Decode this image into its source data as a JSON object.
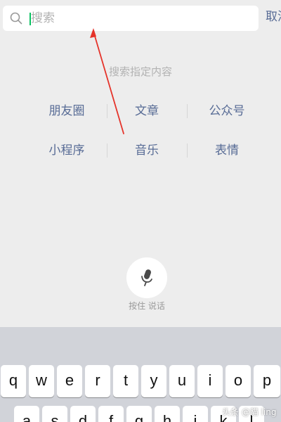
{
  "search": {
    "placeholder": "搜索",
    "cancel_label": "取消"
  },
  "hint": "搜索指定内容",
  "categories": [
    {
      "label": "朋友圈"
    },
    {
      "label": "文章"
    },
    {
      "label": "公众号"
    },
    {
      "label": "小程序"
    },
    {
      "label": "音乐"
    },
    {
      "label": "表情"
    }
  ],
  "voice": {
    "label": "按住 说话"
  },
  "keyboard": {
    "row1": [
      "q",
      "w",
      "e",
      "r",
      "t",
      "y",
      "u",
      "i",
      "o",
      "p"
    ],
    "row2": [
      "a",
      "s",
      "d",
      "f",
      "g",
      "h",
      "j",
      "k",
      "l"
    ]
  },
  "watermark": "头条 @貓 ling",
  "colors": {
    "accent_link": "#576b95",
    "caret": "#07c160",
    "arrow": "#e5332a"
  },
  "icons": {
    "search": "search-icon",
    "mic": "microphone-icon"
  }
}
